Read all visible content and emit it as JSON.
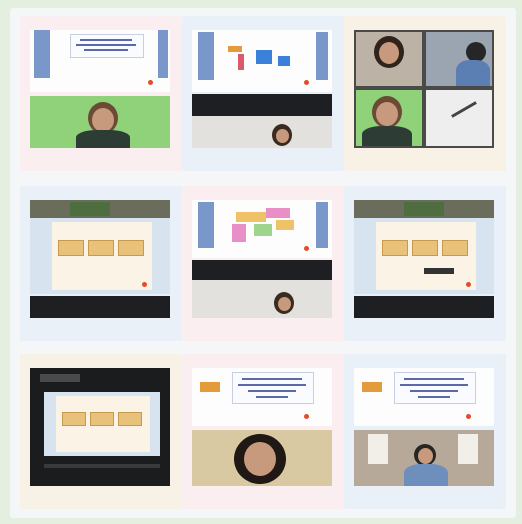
{
  "collage": {
    "description_cells": 9
  }
}
